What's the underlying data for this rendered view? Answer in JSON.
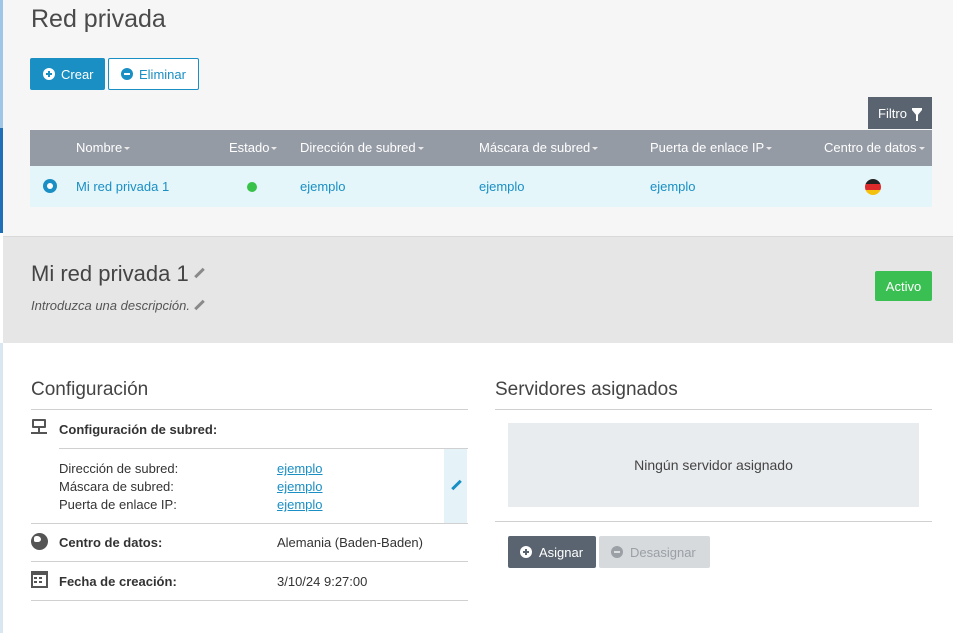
{
  "page": {
    "title": "Red privada"
  },
  "toolbar": {
    "create_label": "Crear",
    "delete_label": "Eliminar",
    "filter_label": "Filtro"
  },
  "table": {
    "columns": [
      "Nombre",
      "Estado",
      "Dirección de subred",
      "Máscara de subred",
      "Puerta de enlace IP",
      "Centro de datos"
    ],
    "rows": [
      {
        "name": "Mi red privada 1",
        "status": "active",
        "subnet": "ejemplo",
        "mask": "ejemplo",
        "gateway": "ejemplo",
        "datacenter_flag": "germany-flag-icon"
      }
    ]
  },
  "detail": {
    "title": "Mi red privada 1",
    "description_placeholder": "Introduzca una descripción.",
    "status_badge": "Activo"
  },
  "config": {
    "title": "Configuración",
    "subnet_config_label": "Configuración de subred:",
    "subnet_address_label": "Dirección de subred:",
    "subnet_address_value": "ejemplo",
    "subnet_mask_label": "Máscara de subred:",
    "subnet_mask_value": "ejemplo",
    "gateway_label": "Puerta de enlace IP:",
    "gateway_value": "ejemplo",
    "datacenter_label": "Centro de datos:",
    "datacenter_value": "Alemania (Baden-Baden)",
    "created_label": "Fecha de creación:",
    "created_value": "3/10/24 9:27:00"
  },
  "servers": {
    "title": "Servidores asignados",
    "empty_text": "Ningún servidor asignado",
    "assign_label": "Asignar",
    "unassign_label": "Desasignar"
  },
  "colors": {
    "accent": "#1a8fc4",
    "active": "#3ac052",
    "header": "#959ba5",
    "dark_button": "#5a6470"
  }
}
